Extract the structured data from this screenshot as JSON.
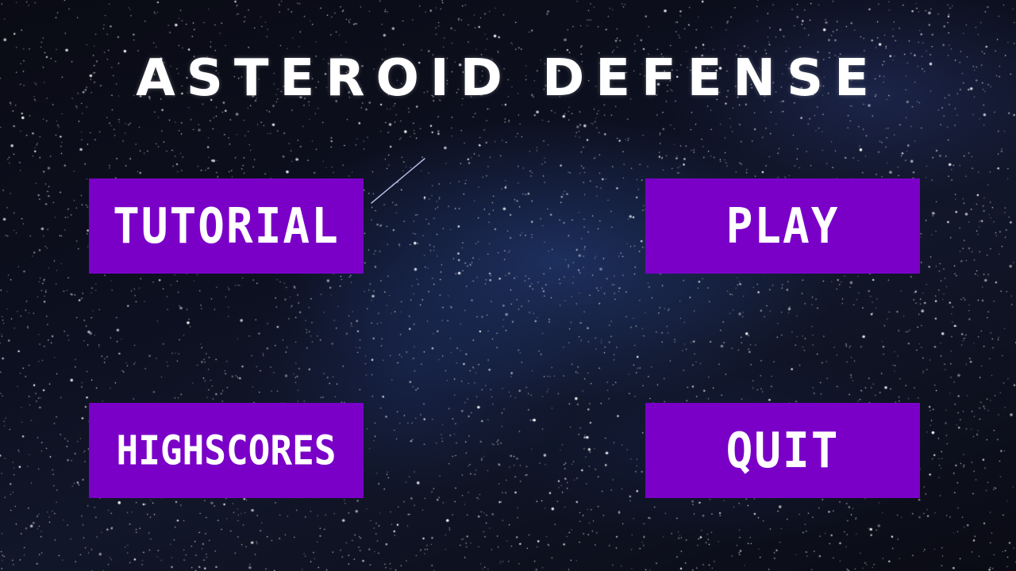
{
  "title": "Asteroid Defense",
  "menu": {
    "tutorial_label": "TUTORiAL",
    "play_label": "PLAY",
    "highscores_label": "HiGHSCORES",
    "quit_label": "QUiT"
  },
  "colors": {
    "button_bg": "#7a00c8",
    "text": "#ffffff",
    "background": "#0d1020"
  }
}
